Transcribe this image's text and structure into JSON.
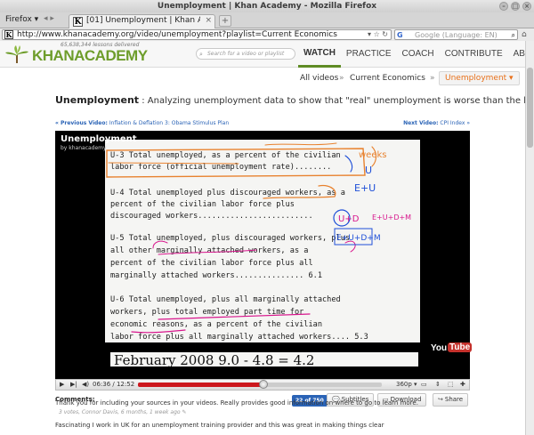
{
  "window": {
    "title": "Unemployment | Khan Academy - Mozilla Firefox"
  },
  "tabs": {
    "firefox_menu": "Firefox",
    "active_tab_label": "[01] Unemployment | Khan A...",
    "new_tab": "+"
  },
  "navbar": {
    "url": "http://www.khanacademy.org/video/unemployment?playlist=Current Economics",
    "search_placeholder": "Google (Language: EN)",
    "search_engine": "G"
  },
  "site": {
    "lessons_delivered": "65,638,344 lessons delivered",
    "logo_left": "KHAN",
    "logo_right": "ACADEMY",
    "search_placeholder": "Search for a video or playlist",
    "nav": [
      "WATCH",
      "PRACTICE",
      "COACH",
      "CONTRIBUTE",
      "ABOUT"
    ],
    "active_nav": "WATCH"
  },
  "breadcrumbs": {
    "all": "All videos",
    "sep": "»",
    "playlist": "Current Economics",
    "current": "Unemployment ▾"
  },
  "video_page": {
    "title": "Unemployment",
    "subtitle": " : Analyzing unemployment data to show that \"real\" unemployment is worse than the headline n",
    "prev_label": "« Previous Video:",
    "prev_title": "Inflation & Deflation 3: Obama Stimulus Plan",
    "next_label": "Next Video:",
    "next_title": "CPI Index »"
  },
  "player": {
    "title": "Unemployment",
    "by": "by khanacademy",
    "time": "06:36 / 12:52",
    "quality": "360p",
    "progress": 0.513,
    "overlay_lines": [
      "U-3 Total unemployed, as a percent of the civilian",
      "     labor force (official unemployment rate)........",
      "U-4 Total unemployed plus discouraged workers, as a",
      "     percent of the civilian labor force plus",
      "     discouraged workers.........................",
      "U-5 Total unemployed, plus discouraged workers, plus",
      "     all other marginally attached workers, as a",
      "     percent of the civilian labor force plus all",
      "     marginally attached workers............... 6.1",
      "U-6 Total unemployed, plus all marginally attached",
      "     workers, plus total employed part time for",
      "     economic reasons, as a percent of the civilian",
      "     labor force plus all marginally attached workers.... 5.3"
    ],
    "annotations": [
      "weeks",
      "U",
      "E+U",
      "U+D",
      "E+U+D+M",
      "E+U+D+M"
    ],
    "bottom_formula": "February 2008   9.0 - 4.8 = 4.2",
    "youtube_you": "You",
    "youtube_tube": "Tube"
  },
  "comments_bar": {
    "label": "Comments:",
    "count": "22 of 750",
    "subtitles": "Subtitles",
    "download": "Download",
    "share": "Share"
  },
  "comments": [
    {
      "text": "Thank you for including your sources in your videos. Really provides good information on where to go to learn more.",
      "meta": "3 votes, Connor Davis, 6 months, 1 week ago"
    },
    {
      "text": "Fascinating I work in UK for an unemployment training provider and this was great in making things clear"
    }
  ],
  "colors": {
    "brand_green": "#6e9d2b",
    "link_blue": "#2a63b6",
    "breadcrumb_orange": "#e8701a",
    "progress_red": "#cc181e",
    "annotation_orange": "#e8822f",
    "annotation_magenta": "#d8168d",
    "annotation_blue": "#1e4fd8"
  }
}
